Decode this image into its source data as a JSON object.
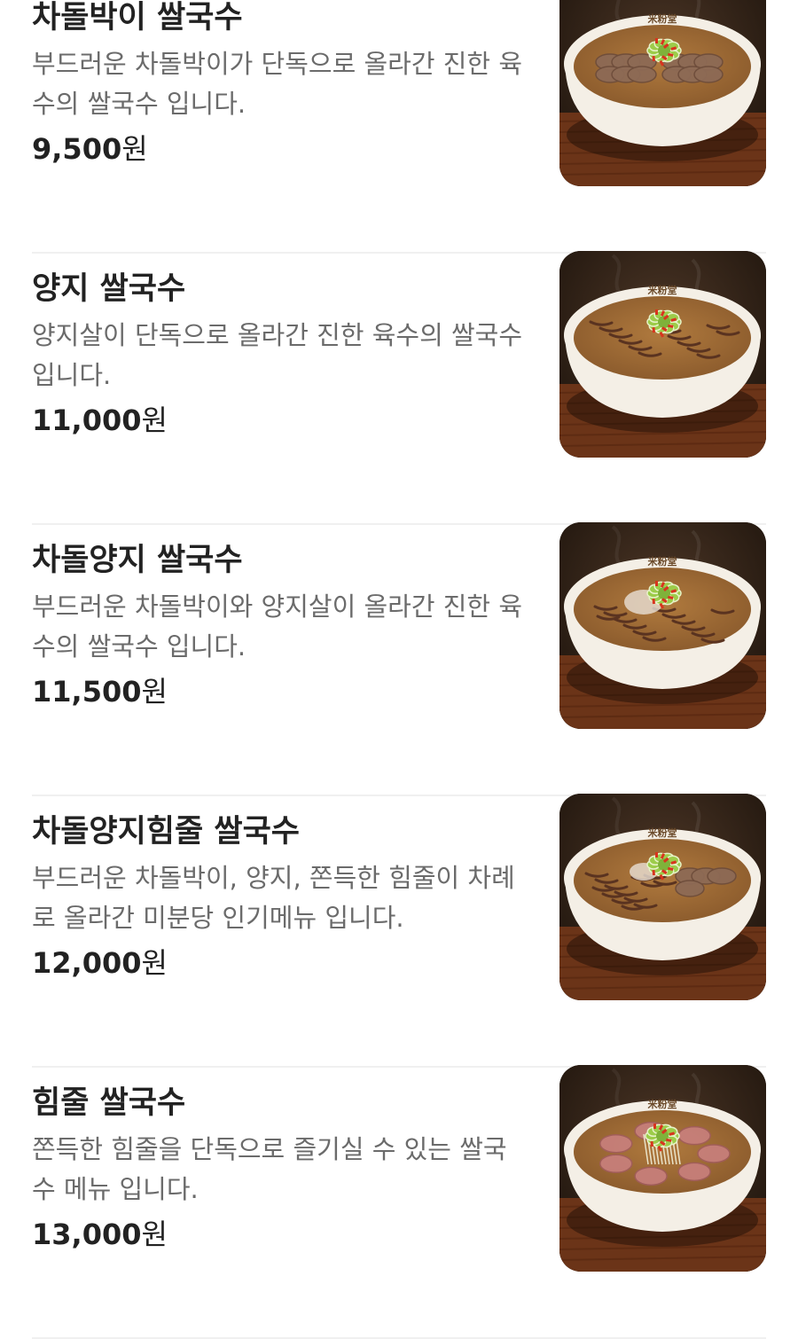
{
  "menu": {
    "items": [
      {
        "name": "차돌박이 쌀국수",
        "description": "부드러운 차돌박이가 단독으로 올라간 진한 육수의 쌀국수 입니다.",
        "price": "9,500",
        "unit": "원",
        "photo_icon": "beef-brisket-pho-photo"
      },
      {
        "name": "양지 쌀국수",
        "description": "양지살이 단독으로 올라간 진한 육수의 쌀국수 입니다.",
        "price": "11,000",
        "unit": "원",
        "photo_icon": "beef-flank-pho-photo"
      },
      {
        "name": "차돌양지 쌀국수",
        "description": "부드러운 차돌박이와 양지살이 올라간 진한 육수의 쌀국수 입니다.",
        "price": "11,500",
        "unit": "원",
        "photo_icon": "brisket-flank-pho-photo"
      },
      {
        "name": "차돌양지힘줄 쌀국수",
        "description": "부드러운 차돌박이, 양지, 쫀득한 힘줄이 차례로 올라간 미분당 인기메뉴 입니다.",
        "price": "12,000",
        "unit": "원",
        "photo_icon": "combo-pho-photo"
      },
      {
        "name": "힘줄 쌀국수",
        "description": "쫀득한 힘줄을 단독으로 즐기실 수 있는 쌀국수 메뉴 입니다.",
        "price": "13,000",
        "unit": "원",
        "photo_icon": "tendon-pho-photo"
      }
    ]
  },
  "bowl_logo_text": "米粉堂",
  "colors": {
    "text_primary": "#222222",
    "text_secondary": "#6b6b6b",
    "divider": "#f0f0f0",
    "background": "#ffffff",
    "photo_background": "#2a1c12",
    "broth": "#8a5a2c",
    "bowl": "#f4efe6"
  }
}
